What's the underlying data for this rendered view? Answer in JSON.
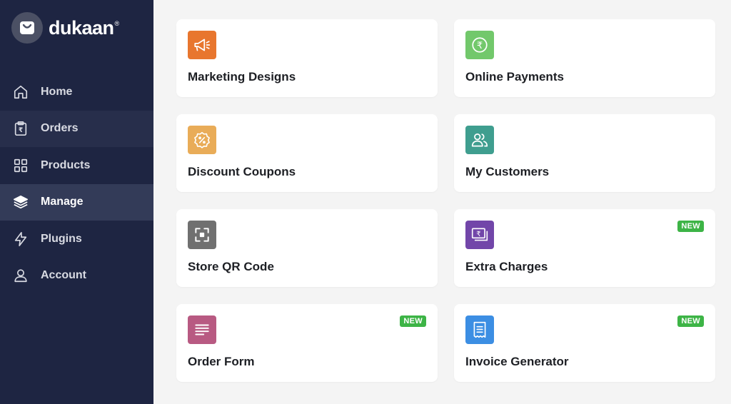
{
  "brand": {
    "name": "dukaan",
    "reg": "®"
  },
  "nav": [
    {
      "label": "Home"
    },
    {
      "label": "Orders"
    },
    {
      "label": "Products"
    },
    {
      "label": "Manage"
    },
    {
      "label": "Plugins"
    },
    {
      "label": "Account"
    }
  ],
  "active_nav": "Manage",
  "cards": [
    {
      "title": "Marketing Designs",
      "icon": "megaphone-icon",
      "color": "#e8762e",
      "badge": ""
    },
    {
      "title": "Online Payments",
      "icon": "rupee-circle-icon",
      "color": "#72c86b",
      "badge": ""
    },
    {
      "title": "Discount Coupons",
      "icon": "discount-badge-icon",
      "color": "#e9ac58",
      "badge": ""
    },
    {
      "title": "My Customers",
      "icon": "users-icon",
      "color": "#3f9e8f",
      "badge": ""
    },
    {
      "title": "Store QR Code",
      "icon": "qr-scan-icon",
      "color": "#707070",
      "badge": ""
    },
    {
      "title": "Extra Charges",
      "icon": "rupee-note-icon",
      "color": "#7246a9",
      "badge": "NEW"
    },
    {
      "title": "Order Form",
      "icon": "form-lines-icon",
      "color": "#b85a82",
      "badge": "NEW"
    },
    {
      "title": "Invoice Generator",
      "icon": "receipt-icon",
      "color": "#3c8ee3",
      "badge": "NEW"
    }
  ]
}
